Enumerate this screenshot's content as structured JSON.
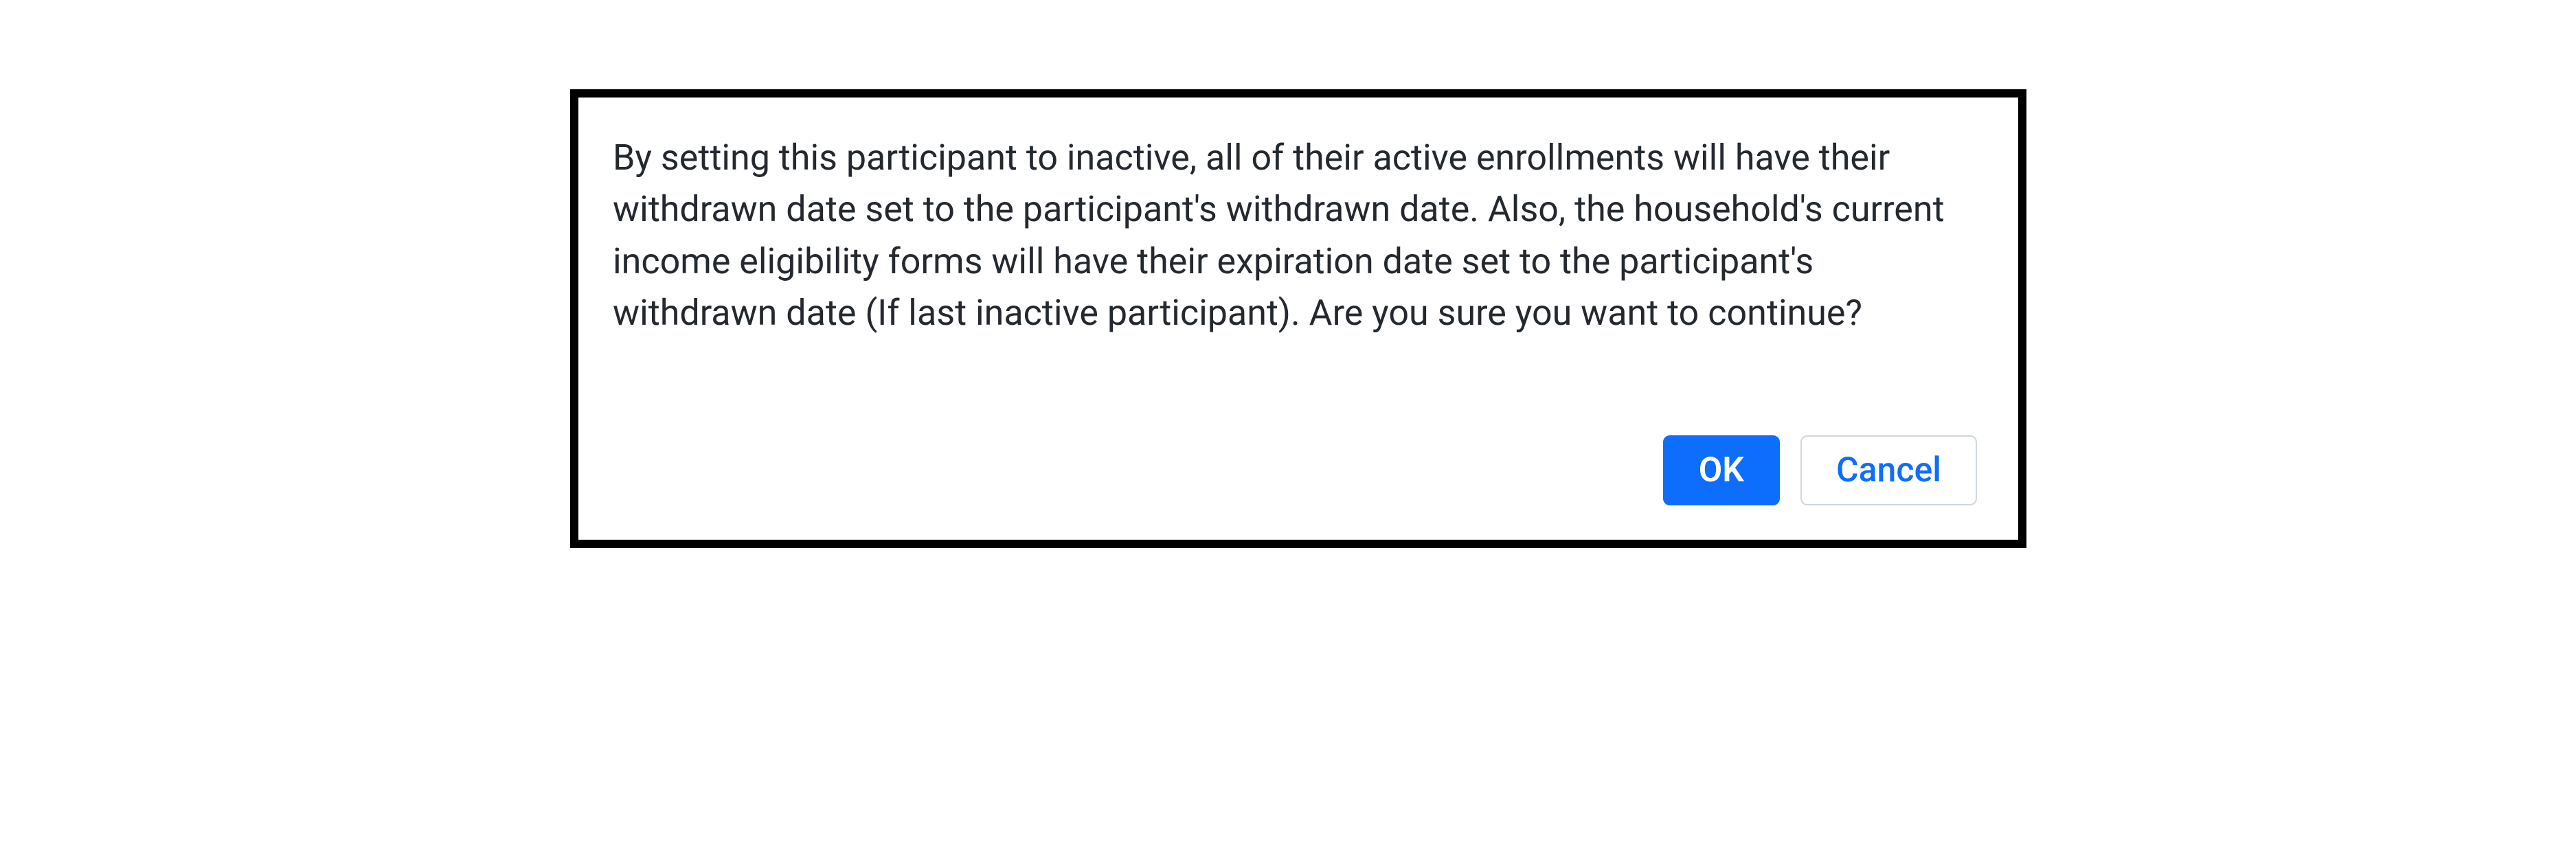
{
  "dialog": {
    "message": "By setting this participant to inactive, all of their active enrollments will have their withdrawn date set to the participant's withdrawn date. Also, the household's current income eligibility forms will have their expiration date set to the participant's withdrawn date (If last inactive participant). Are you sure you want to continue?",
    "ok_label": "OK",
    "cancel_label": "Cancel"
  }
}
